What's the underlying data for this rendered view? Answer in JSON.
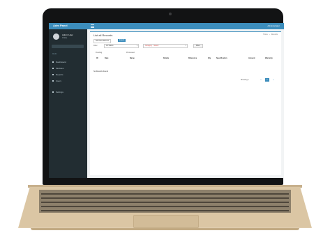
{
  "app": {
    "brand": "Adm Panel",
    "user_top": "Administrator"
  },
  "sidebar": {
    "user": {
      "name": "Admin User",
      "status": "Online"
    },
    "header": "MAIN",
    "items": [
      {
        "label": "Dashboard"
      },
      {
        "label": "Modules"
      },
      {
        "label": "Reports"
      },
      {
        "label": "Users"
      },
      {
        "label": "Settings"
      }
    ]
  },
  "page": {
    "title": "List all Records",
    "breadcrumb": [
      "Home",
      "Records"
    ],
    "new_button": "Add New Record",
    "primary_button": "Export"
  },
  "filters": {
    "label": "Filter",
    "status": "All Status",
    "category": "Category - Select",
    "filter_button": "Filter"
  },
  "tabs": [
    "Pending",
    "Processed"
  ],
  "table": {
    "columns": [
      "ID",
      "Date",
      "Name",
      "Details",
      "Reference",
      "Qty",
      "Specification",
      "Amount",
      "Warranty"
    ],
    "empty_text": "No Records Found"
  },
  "pagination": {
    "info": "Showing 1",
    "pages": [
      "«",
      "1",
      "»"
    ],
    "active": "1"
  }
}
